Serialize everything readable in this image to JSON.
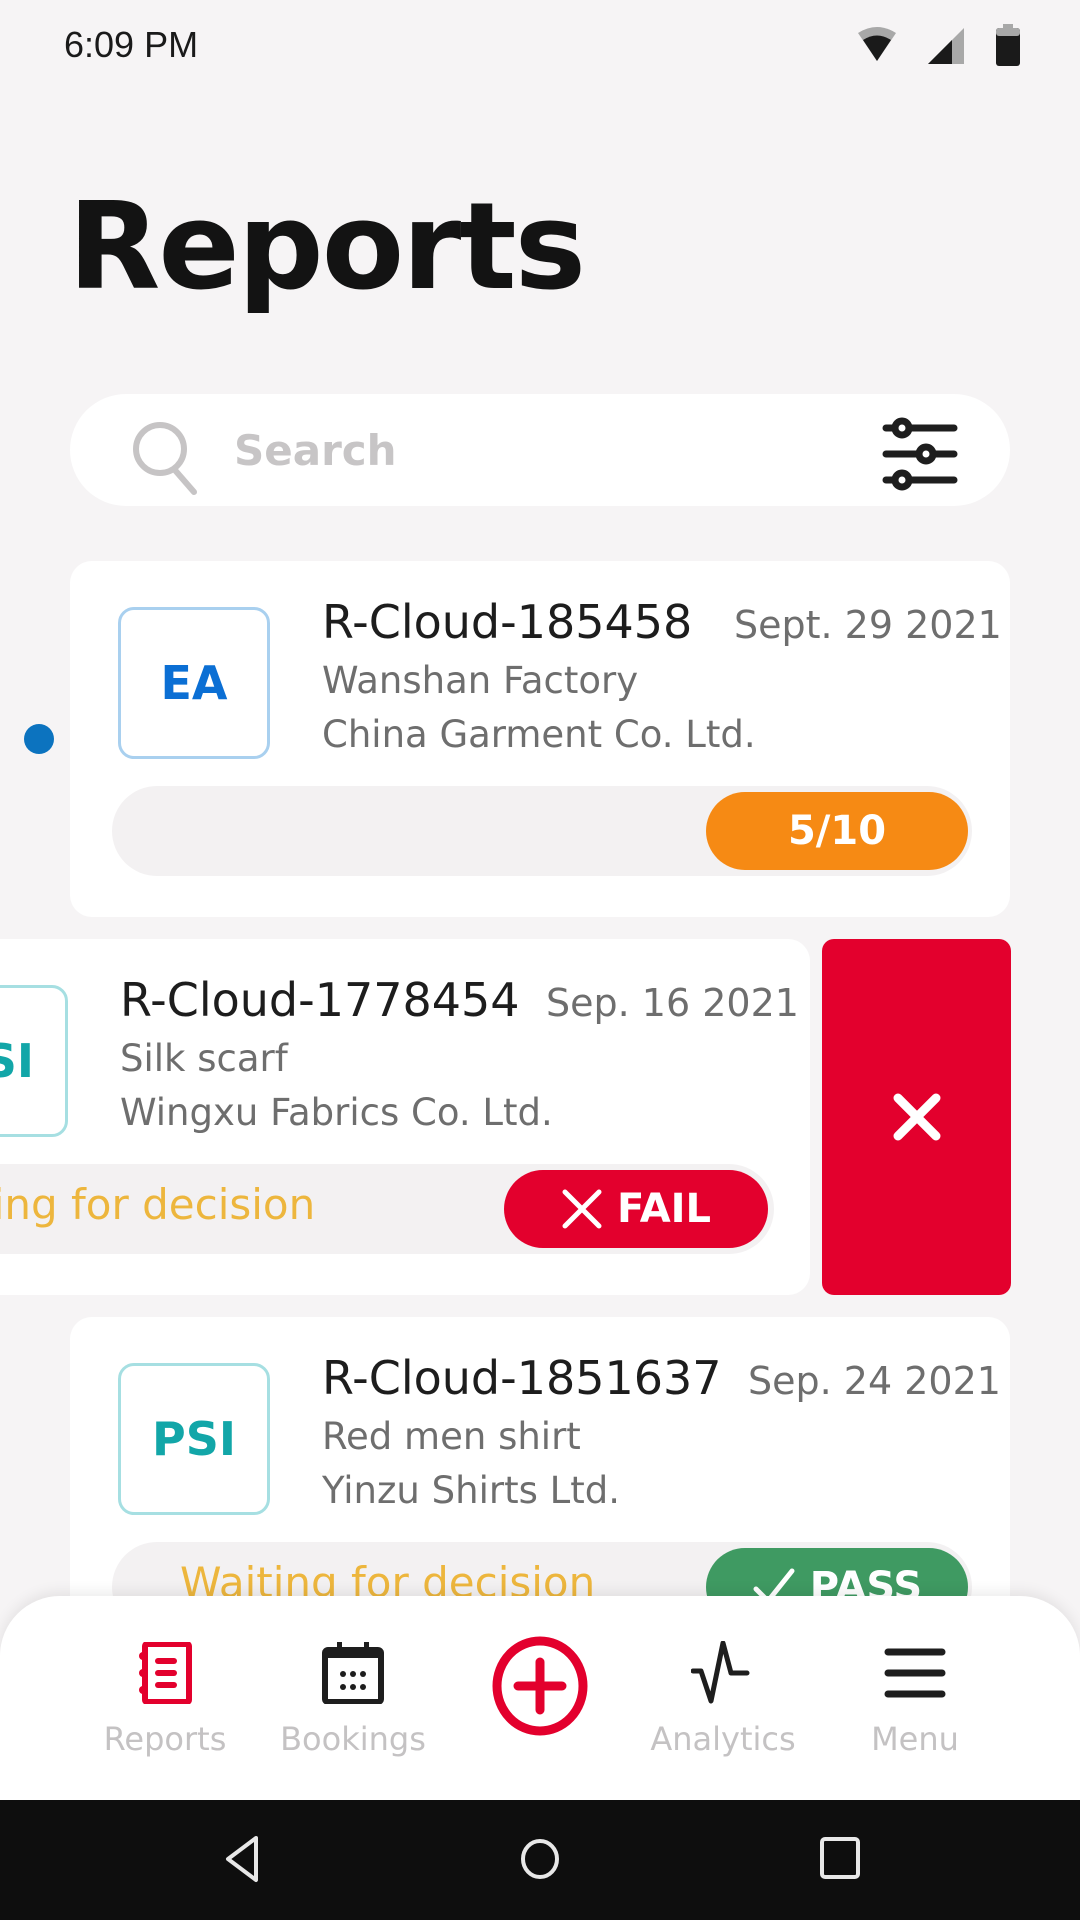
{
  "status_bar": {
    "time": "6:09 PM",
    "icons": [
      "wifi-icon",
      "cell-signal-icon",
      "battery-icon"
    ]
  },
  "header": {
    "title": "Reports"
  },
  "search": {
    "placeholder": "Search",
    "value": "",
    "left_icon": "search-icon",
    "right_icon": "filter-sliders-icon"
  },
  "reports": [
    {
      "type_code": "EA",
      "type_color": "#0b6fd4",
      "type_border": "#a9d0ef",
      "id": "R-Cloud-185458",
      "date": "Sept. 29 2021",
      "product": "Wanshan Factory",
      "company": "China Garment Co. Ltd.",
      "unread": true,
      "status_text": "",
      "progress_label": "5/10",
      "progress_value": 0.5,
      "result_color": "#f68a14"
    },
    {
      "type_code": "PSI",
      "type_color": "#12a6a8",
      "type_border": "#a6dfe2",
      "id": "R-Cloud-1778454",
      "date": "Sep. 16 2021",
      "product": "Silk scarf",
      "company": "Wingxu Fabrics Co. Ltd.",
      "unread": false,
      "status_text": "Waiting for decision",
      "result_label": "FAIL",
      "result_icon": "x-icon",
      "result_color": "#e3002d",
      "swiped": true,
      "swipe_action": {
        "icon": "close-icon",
        "color": "#e3002d"
      }
    },
    {
      "type_code": "PSI",
      "type_color": "#12a6a8",
      "type_border": "#a6dfe2",
      "id": "R-Cloud-1851637",
      "date": "Sep. 24 2021",
      "product": "Red men shirt",
      "company": "Yinzu Shirts Ltd.",
      "unread": false,
      "status_text": "Waiting for decision",
      "result_label": "PASS",
      "result_icon": "check-icon",
      "result_color": "#3f9a62"
    }
  ],
  "bottom_nav": {
    "active_color": "#e3002d",
    "items": [
      {
        "label": "Reports",
        "icon": "reports-notebook-icon",
        "active": true
      },
      {
        "label": "Bookings",
        "icon": "calendar-icon",
        "active": false
      },
      {
        "label": "",
        "icon": "add-circle-icon",
        "active": false
      },
      {
        "label": "Analytics",
        "icon": "pulse-chart-icon",
        "active": false
      },
      {
        "label": "Menu",
        "icon": "hamburger-menu-icon",
        "active": false
      }
    ]
  },
  "system_nav": {
    "buttons": [
      "back-icon",
      "home-icon",
      "recents-icon"
    ]
  }
}
